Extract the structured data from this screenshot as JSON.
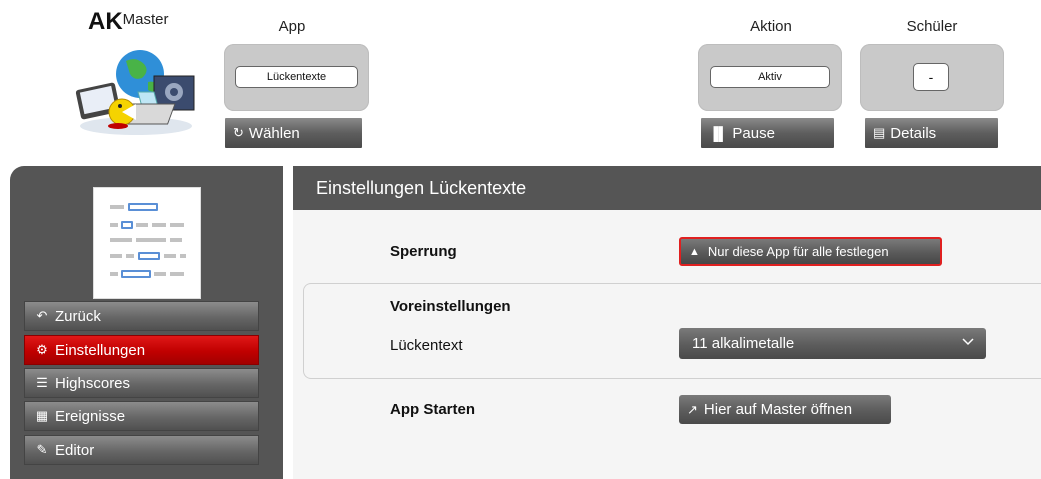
{
  "brand": {
    "bold": "AK",
    "rest": "Master"
  },
  "header": {
    "app": {
      "label": "App",
      "value": "Lückentexte",
      "button": "Wählen",
      "button_icon": "refresh-icon"
    },
    "action": {
      "label": "Aktion",
      "value": "Aktiv",
      "button": "Pause",
      "button_icon": "pause-icon"
    },
    "student": {
      "label": "Schüler",
      "value": "-",
      "button": "Details",
      "button_icon": "list-icon"
    }
  },
  "sidebar": {
    "items": [
      {
        "label": "Zurück",
        "icon": "back-arrow-icon",
        "active": false
      },
      {
        "label": "Einstellungen",
        "icon": "gear-icon",
        "active": true
      },
      {
        "label": "Highscores",
        "icon": "list-icon",
        "active": false
      },
      {
        "label": "Ereignisse",
        "icon": "calendar-icon",
        "active": false
      },
      {
        "label": "Editor",
        "icon": "edit-icon",
        "active": false
      }
    ]
  },
  "main": {
    "title": "Einstellungen Lückentexte",
    "lock": {
      "label": "Sperrung",
      "button": "Nur diese App für alle festlegen",
      "icon": "lock-icon"
    },
    "presets": {
      "heading": "Voreinstellungen",
      "field_label": "Lückentext",
      "selected": "11 alkalimetalle"
    },
    "start": {
      "label": "App Starten",
      "button": "Hier auf Master öffnen",
      "icon": "external-link-icon"
    }
  },
  "colors": {
    "accent_red": "#c00000",
    "panel_gray": "#555555",
    "lock_border": "#e02020"
  }
}
